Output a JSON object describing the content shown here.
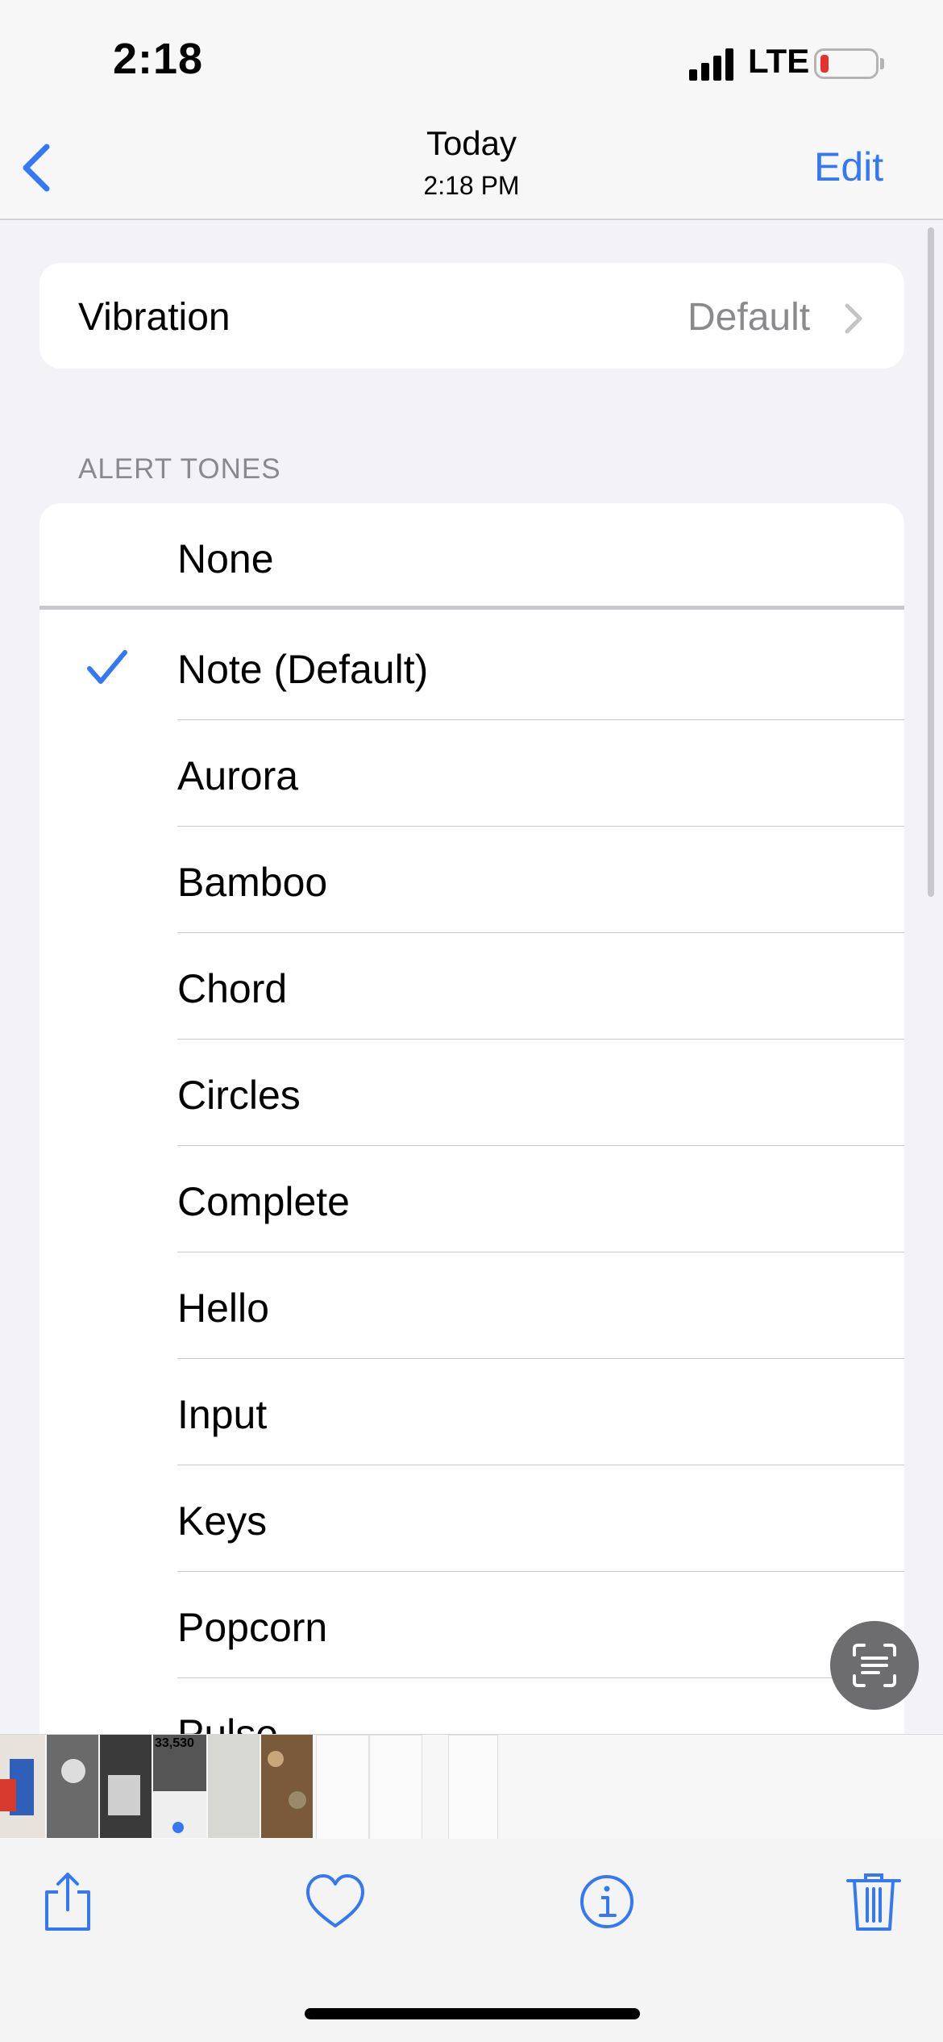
{
  "status_bar": {
    "time": "2:18",
    "network": "LTE"
  },
  "nav": {
    "title": "Today",
    "subtitle": "2:18 PM",
    "edit_label": "Edit"
  },
  "vibration": {
    "label": "Vibration",
    "value": "Default"
  },
  "alert_tones": {
    "header": "ALERT TONES",
    "selected": "Note (Default)",
    "items": [
      "None",
      "Note (Default)",
      "Aurora",
      "Bamboo",
      "Chord",
      "Circles",
      "Complete",
      "Hello",
      "Input",
      "Keys",
      "Popcorn",
      "Pulse"
    ]
  },
  "thumbnail_strip": {
    "visible_text": "33,530"
  },
  "colors": {
    "accent": "#3478f6",
    "secondary_text": "#8a8a8e",
    "background": "#f2f2f7"
  },
  "toolbar": {
    "icons": [
      "share-icon",
      "heart-icon",
      "info-icon",
      "trash-icon"
    ]
  }
}
